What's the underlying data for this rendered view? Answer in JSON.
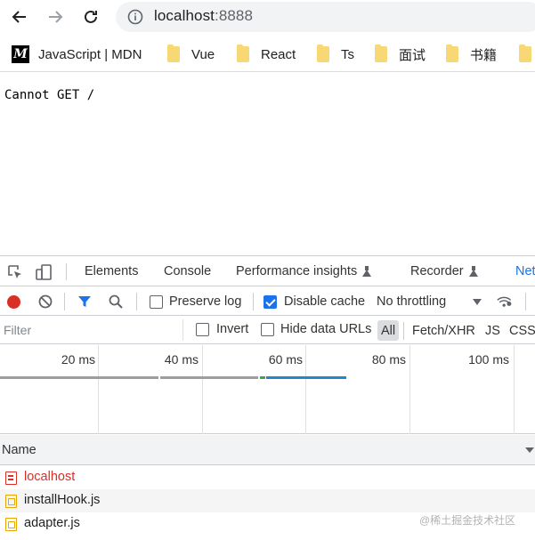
{
  "browser": {
    "url_host": "localhost",
    "url_port": ":8888",
    "bookmarks": [
      {
        "label": "JavaScript | MDN",
        "icon": "mdn-icon"
      },
      {
        "label": "Vue",
        "icon": "folder-icon"
      },
      {
        "label": "React",
        "icon": "folder-icon"
      },
      {
        "label": "Ts",
        "icon": "folder-icon"
      },
      {
        "label": "面试",
        "icon": "folder-icon"
      },
      {
        "label": "书籍",
        "icon": "folder-icon"
      }
    ]
  },
  "page": {
    "message": "Cannot GET /"
  },
  "devtools": {
    "tabs": [
      "Elements",
      "Console",
      "Performance insights",
      "Recorder",
      "Net"
    ],
    "active_tab": "Net",
    "network": {
      "preserve_log": {
        "label": "Preserve log",
        "checked": false
      },
      "disable_cache": {
        "label": "Disable cache",
        "checked": true
      },
      "throttling": "No throttling",
      "filter_placeholder": "Filter",
      "invert": {
        "label": "Invert",
        "checked": false
      },
      "hide_data_urls": {
        "label": "Hide data URLs",
        "checked": false
      },
      "type_filters": [
        "All",
        "Fetch/XHR",
        "JS",
        "CSS"
      ],
      "active_type": "All",
      "timeline_ticks": [
        "20 ms",
        "40 ms",
        "60 ms",
        "80 ms",
        "100 ms"
      ],
      "column_name": "Name",
      "requests": [
        {
          "name": "localhost",
          "type": "document",
          "error": true
        },
        {
          "name": "installHook.js",
          "type": "script",
          "error": false
        },
        {
          "name": "adapter.js",
          "type": "script",
          "error": false
        }
      ]
    }
  },
  "watermark": "@稀土掘金技术社区",
  "colors": {
    "accent": "#1a73e8",
    "error": "#d93025",
    "folder": "#f8d775"
  }
}
